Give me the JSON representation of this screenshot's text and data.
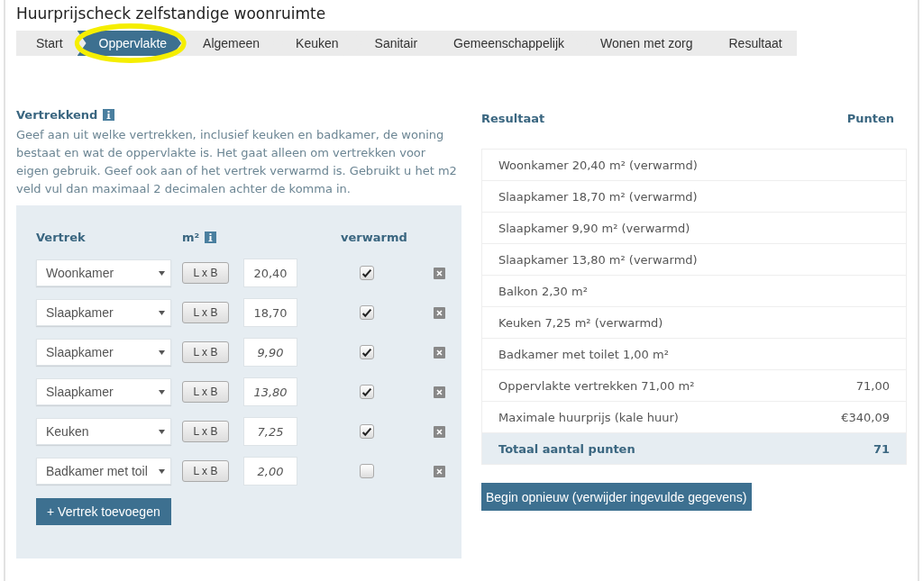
{
  "title": "Huurprijscheck zelfstandige woonruimte",
  "steps": [
    {
      "label": "Start",
      "selected": false,
      "highlighted": false
    },
    {
      "label": "Oppervlakte",
      "selected": true,
      "highlighted": true
    },
    {
      "label": "Algemeen",
      "selected": false,
      "highlighted": false
    },
    {
      "label": "Keuken",
      "selected": false,
      "highlighted": false
    },
    {
      "label": "Sanitair",
      "selected": false,
      "highlighted": false
    },
    {
      "label": "Gemeenschappelijk",
      "selected": false,
      "highlighted": false
    },
    {
      "label": "Wonen met zorg",
      "selected": false,
      "highlighted": false
    },
    {
      "label": "Resultaat",
      "selected": false,
      "highlighted": false
    }
  ],
  "rooms_section": {
    "heading": "Vertrekkend",
    "description": "Geef aan uit welke vertrekken, inclusief keuken en badkamer, de woning bestaat en wat de oppervlakte is. Het gaat alleen om vertrekken voor eigen gebruik. Geef ook aan of het vertrek verwarmd is. Gebruikt u het m2 veld vul dan maximaal 2 decimalen achter de komma in.",
    "columns": {
      "room": "Vertrek",
      "area": "m²",
      "heated": "verwarmd"
    },
    "rooms": [
      {
        "room": "Woonkamer",
        "measure_label": "L x B",
        "area": "20,40",
        "calculated": false,
        "heated": true
      },
      {
        "room": "Slaapkamer",
        "measure_label": "L x B",
        "area": "18,70",
        "calculated": false,
        "heated": true
      },
      {
        "room": "Slaapkamer",
        "measure_label": "L x B",
        "area": "9,90",
        "calculated": true,
        "heated": true
      },
      {
        "room": "Slaapkamer",
        "measure_label": "L x B",
        "area": "13,80",
        "calculated": true,
        "heated": true
      },
      {
        "room": "Keuken",
        "measure_label": "L x B",
        "area": "7,25",
        "calculated": true,
        "heated": true
      },
      {
        "room": "Badkamer met toil",
        "measure_label": "L x B",
        "area": "2,00",
        "calculated": true,
        "heated": false
      }
    ],
    "add_button": "+ Vertrek toevoegen"
  },
  "result": {
    "heading": "Resultaat",
    "points_heading": "Punten",
    "rows": [
      {
        "label": "Woonkamer 20,40 m² (verwarmd)",
        "kind": "item"
      },
      {
        "label": "Slaapkamer 18,70 m² (verwarmd)",
        "kind": "item"
      },
      {
        "label": "Slaapkamer 9,90 m² (verwarmd)",
        "kind": "item"
      },
      {
        "label": "Slaapkamer 13,80 m² (verwarmd)",
        "kind": "item"
      },
      {
        "label": "Balkon 2,30 m²",
        "kind": "item"
      },
      {
        "label": "Keuken 7,25 m² (verwarmd)",
        "kind": "item"
      },
      {
        "label": "Badkamer met toilet 1,00 m²",
        "kind": "item"
      },
      {
        "label": "Oppervlakte vertrekken 71,00 m²",
        "value": "71,00",
        "kind": "item"
      },
      {
        "label": "Maximale huurprijs (kale huur)",
        "value": "€340,09",
        "kind": "item"
      },
      {
        "label": "Totaal aantal punten",
        "value": "71",
        "kind": "total"
      }
    ],
    "reset_button": "Begin opnieuw (verwijder ingevulde gegevens)"
  }
}
